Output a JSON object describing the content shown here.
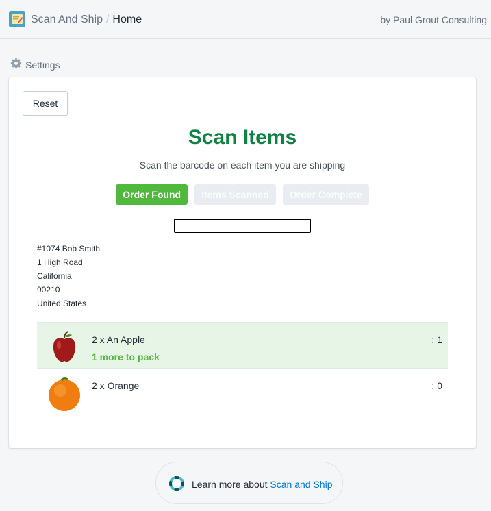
{
  "header": {
    "app_name": "Scan And Ship",
    "separator": "/",
    "page": "Home",
    "byline": "by Paul Grout Consulting"
  },
  "settings": {
    "label": "Settings",
    "icon": "gear-icon"
  },
  "card": {
    "reset_label": "Reset",
    "title": "Scan Items",
    "subtitle": "Scan the barcode on each item you are shipping",
    "steps": [
      {
        "label": "Order Found",
        "active": true
      },
      {
        "label": "Items Scanned",
        "active": false
      },
      {
        "label": "Order Complete",
        "active": false
      }
    ],
    "scan_input": {
      "value": "",
      "placeholder": ""
    },
    "address": [
      "#1074 Bob Smith",
      "1 High Road",
      "California",
      "90210",
      "United States"
    ],
    "items": [
      {
        "name": "2 x An Apple",
        "status": "1 more to pack",
        "count": ": 1",
        "icon": "apple-icon"
      },
      {
        "name": "2 x Orange",
        "status": "",
        "count": ": 0",
        "icon": "orange-icon"
      }
    ]
  },
  "footer": {
    "text": "Learn more about ",
    "link": "Scan and Ship",
    "icon": "help-lifebuoy-icon"
  },
  "colors": {
    "title_green": "#108043",
    "active_step": "#50b83c",
    "packing_row": "#e6f5e6",
    "link": "#007ace"
  }
}
